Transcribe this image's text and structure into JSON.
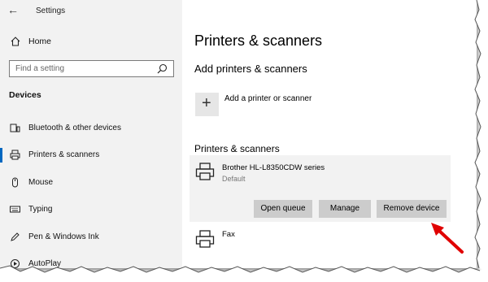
{
  "window": {
    "title": "Settings"
  },
  "sidebar": {
    "home_label": "Home",
    "search_placeholder": "Find a setting",
    "section_title": "Devices",
    "items": [
      {
        "label": "Bluetooth & other devices",
        "icon": "bluetooth-devices-icon"
      },
      {
        "label": "Printers & scanners",
        "icon": "printer-icon",
        "selected": true
      },
      {
        "label": "Mouse",
        "icon": "mouse-icon"
      },
      {
        "label": "Typing",
        "icon": "keyboard-icon"
      },
      {
        "label": "Pen & Windows Ink",
        "icon": "pen-icon"
      },
      {
        "label": "AutoPlay",
        "icon": "autoplay-icon"
      }
    ]
  },
  "main": {
    "page_title": "Printers & scanners",
    "add_section_title": "Add printers & scanners",
    "add_label": "Add a printer or scanner",
    "list_title": "Printers & scanners",
    "devices": [
      {
        "name": "Brother HL-L8350CDW series",
        "status": "Default"
      },
      {
        "name": "Fax"
      }
    ],
    "buttons": {
      "open_queue": "Open queue",
      "manage": "Manage",
      "remove": "Remove device"
    }
  },
  "colors": {
    "accent": "#0067c0",
    "arrow": "#e00000",
    "sidebar_bg": "#f2f2f2",
    "button_bg": "#cccccc"
  }
}
